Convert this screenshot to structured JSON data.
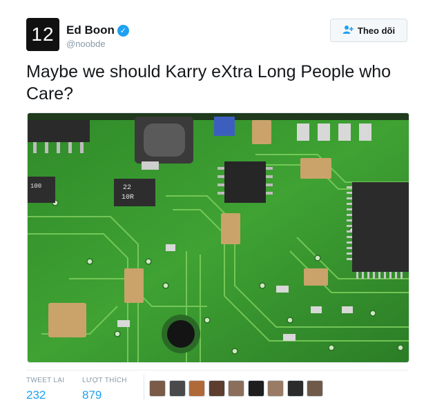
{
  "user": {
    "avatar_text": "12",
    "display_name": "Ed Boon",
    "verified_icon": "verified-badge-icon",
    "handle": "@noobde"
  },
  "follow_button": {
    "icon": "add-user-icon",
    "label": "Theo dõi"
  },
  "tweet": {
    "text": "Maybe we should Karry eXtra Long People who Care?"
  },
  "media": {
    "description_icon": "circuit-board-photo",
    "chip_labels": [
      "22",
      "10R",
      "100"
    ]
  },
  "stats": {
    "retweets_label": "TWEET LẠI",
    "retweets_value": "232",
    "likes_label": "LƯỢT THÍCH",
    "likes_value": "879",
    "liker_count": 9
  },
  "colors": {
    "accent": "#1da1f2",
    "pcb_green": "#3f9a32",
    "text": "#14171a",
    "muted": "#8899a6"
  }
}
